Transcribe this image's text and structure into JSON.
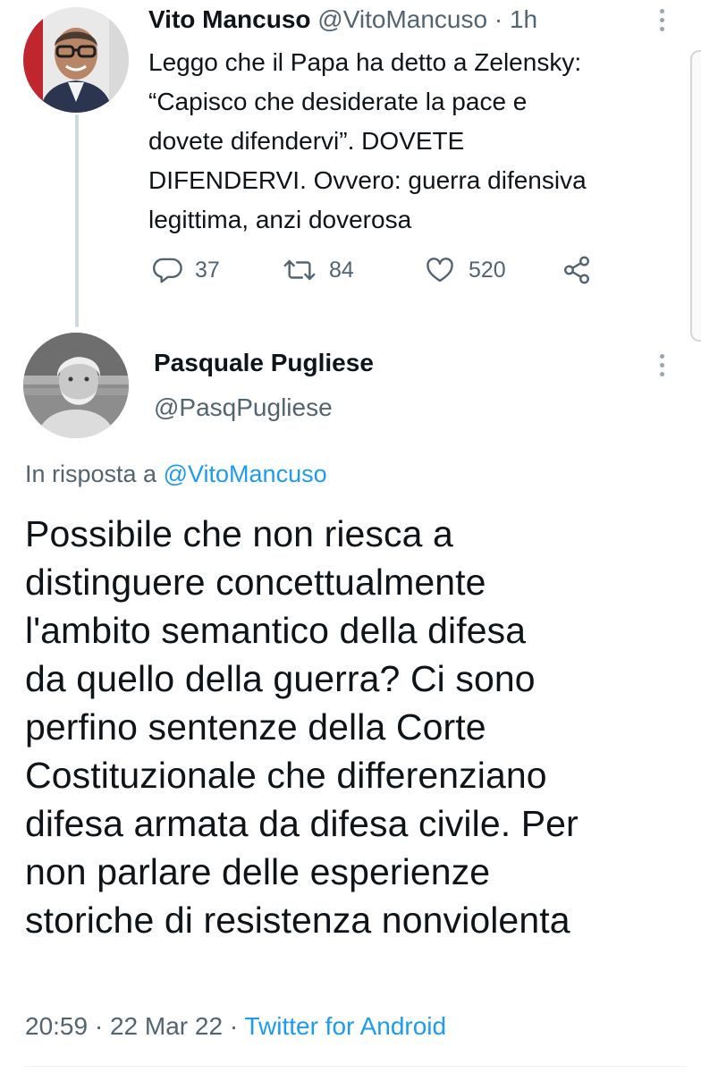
{
  "parent_tweet": {
    "name": "Vito Mancuso",
    "handle": "@VitoMancuso",
    "separator": "·",
    "time": "1h",
    "text_lines": [
      "Leggo che il Papa ha detto a Zelensky:",
      "“Capisco che desiderate la pace e",
      "dovete difendervi”. DOVETE",
      "DIFENDERVI. Ovvero: guerra difensiva",
      "legittima, anzi doverosa"
    ],
    "stats": {
      "replies": "37",
      "retweets": "84",
      "likes": "520"
    }
  },
  "reply_tweet": {
    "name": "Pasquale Pugliese",
    "handle": "@PasqPugliese",
    "reply_prefix": "In risposta a",
    "reply_mention": "@VitoMancuso",
    "text_lines": [
      "Possibile che non riesca a",
      "distinguere concettualmente",
      "l'ambito semantico della difesa",
      "da quello della guerra? Ci sono",
      "perfino sentenze della Corte",
      "Costituzionale che differenziano",
      "difesa armata da difesa civile. Per",
      "non parlare delle esperienze",
      "storiche di resistenza nonviolenta"
    ],
    "time": "20:59",
    "date": "22 Mar 22",
    "separator": "·",
    "client": "Twitter for Android"
  },
  "icons": {
    "reply": "reply-icon",
    "retweet": "retweet-icon",
    "like": "heart-icon",
    "share": "share-icon",
    "more": "more-vertical-icon"
  },
  "colors": {
    "text": "#0f1419",
    "secondary": "#536471",
    "accent": "#1d9bf0",
    "thread_line": "#cfd9de"
  }
}
